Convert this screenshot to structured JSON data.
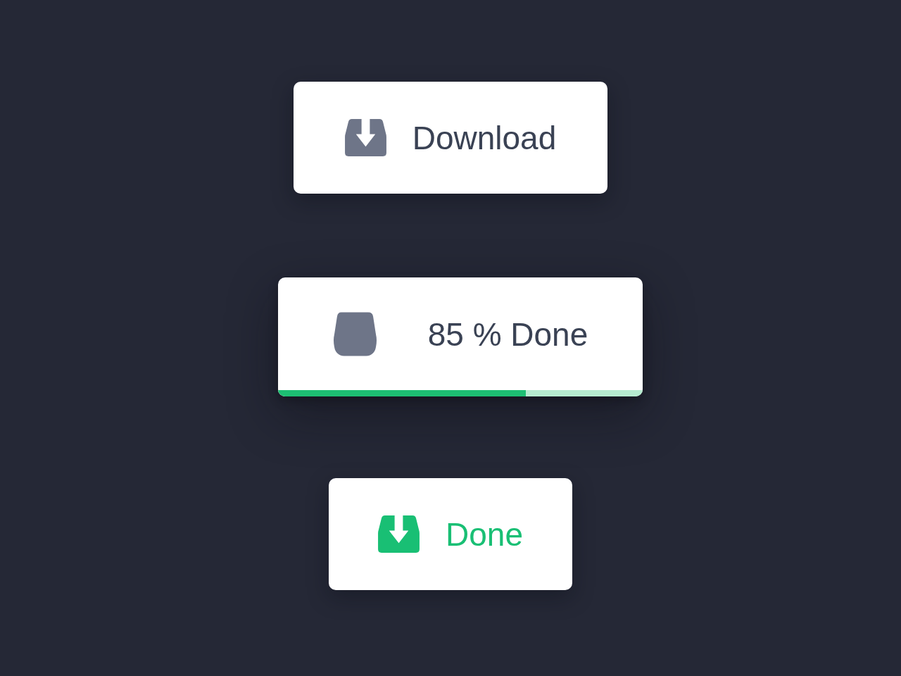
{
  "buttons": [
    {
      "kind": "idle",
      "label": "Download"
    },
    {
      "kind": "progress",
      "label": "85 % Done",
      "level": 0.68
    },
    {
      "kind": "complete",
      "label": "Done"
    }
  ]
}
